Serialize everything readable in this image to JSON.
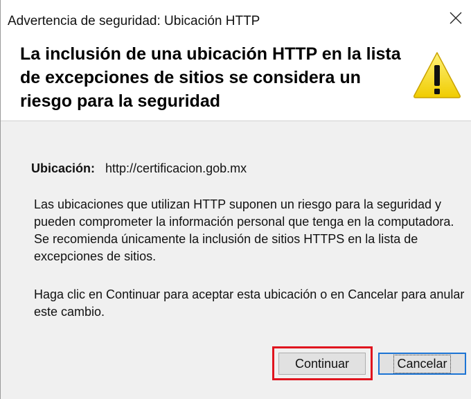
{
  "window": {
    "title": "Advertencia de seguridad: Ubicación HTTP"
  },
  "header": {
    "headline": "La inclusión de una ubicación HTTP en la lista de excepciones de sitios se considera un riesgo para la seguridad",
    "icon": "warning-triangle-icon",
    "icon_color": "#f5d800"
  },
  "body": {
    "location_label": "Ubicación:",
    "location_value": "http://certificacion.gob.mx",
    "paragraph1": "Las ubicaciones que utilizan HTTP suponen un riesgo para la seguridad y pueden comprometer la información personal que tenga en la computadora. Se recomienda únicamente la inclusión de sitios HTTPS en la lista de excepciones de sitios.",
    "paragraph2": "Haga clic en Continuar para aceptar esta ubicación o en Cancelar para anular este cambio."
  },
  "buttons": {
    "continue_label": "Continuar",
    "cancel_label": "Cancelar"
  },
  "colors": {
    "highlight": "#e0141e",
    "focus_border": "#1c74d4",
    "body_background": "#f0f0f0"
  }
}
